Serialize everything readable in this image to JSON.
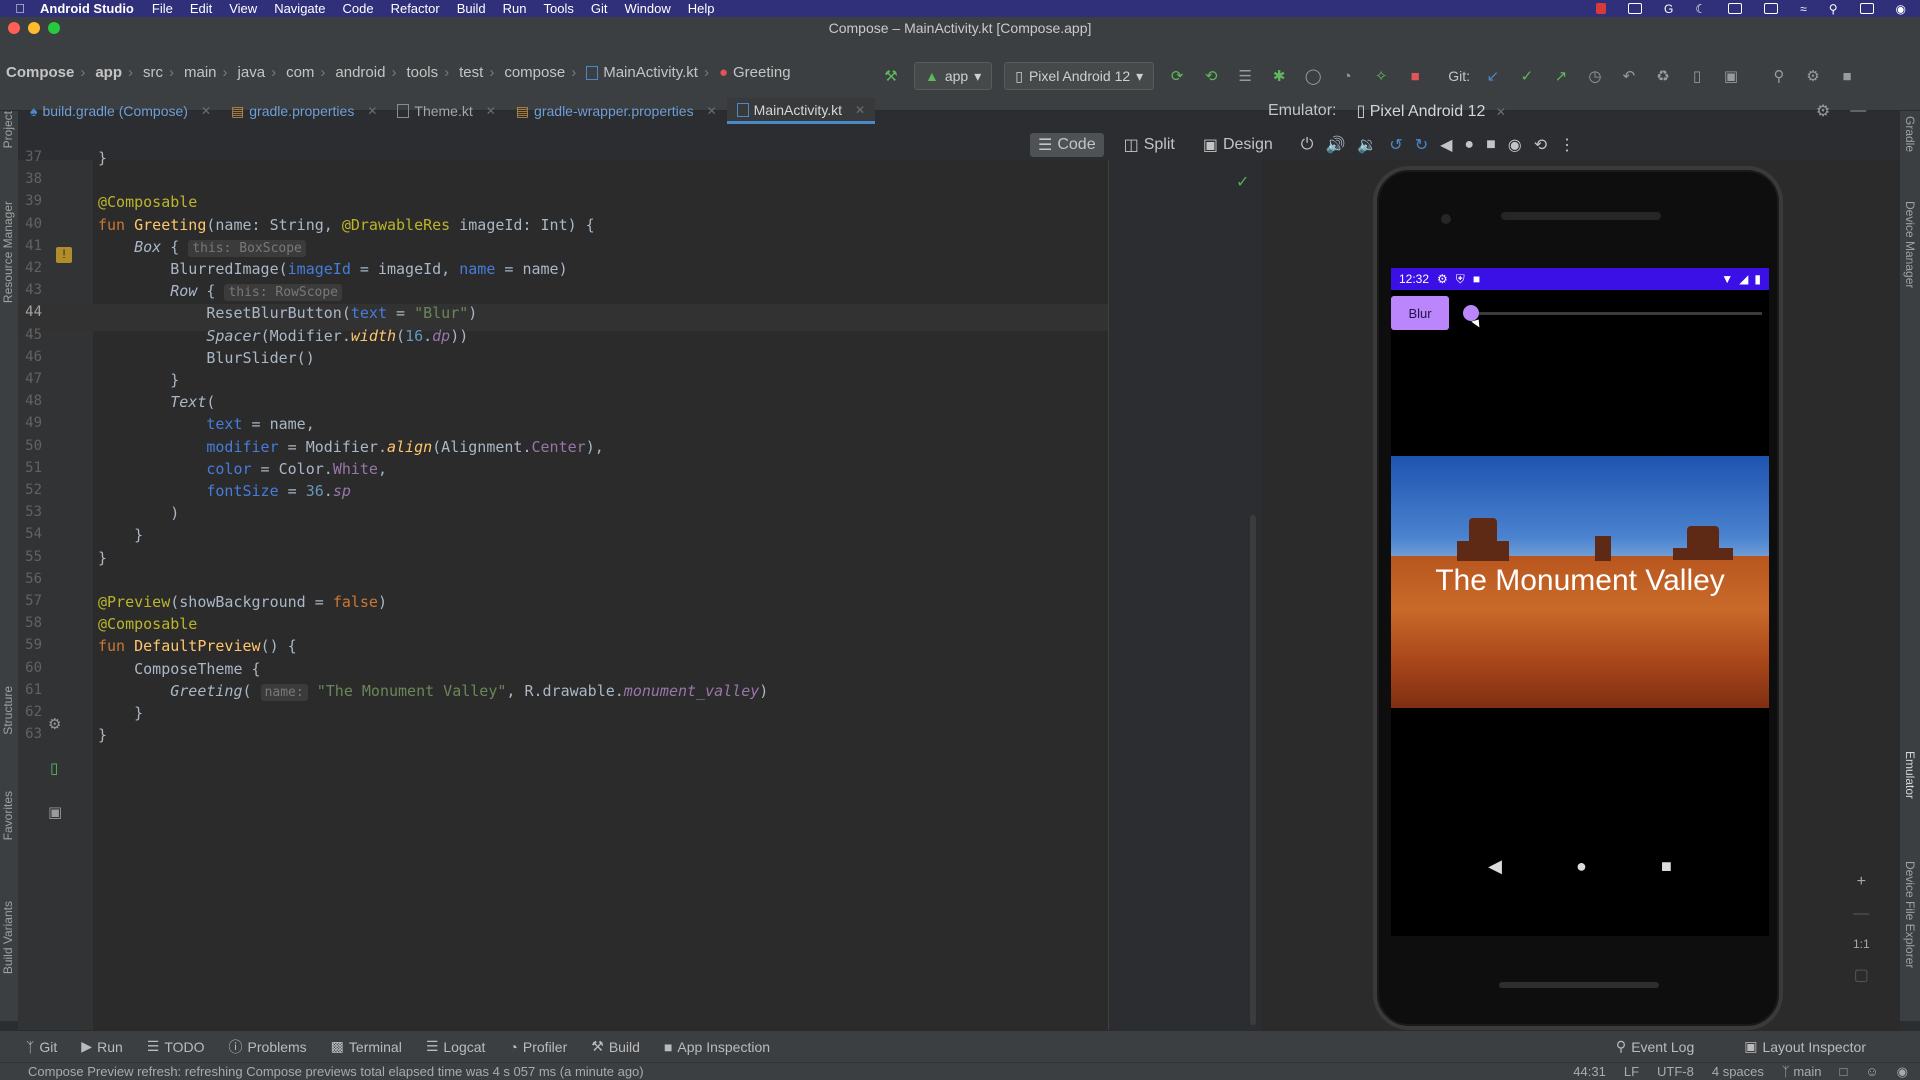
{
  "menubar": {
    "app_name": "Android Studio",
    "menus": [
      "File",
      "Edit",
      "View",
      "Navigate",
      "Code",
      "Refactor",
      "Build",
      "Run",
      "Tools",
      "Git",
      "Window",
      "Help"
    ]
  },
  "window": {
    "title": "Compose – MainActivity.kt [Compose.app]"
  },
  "breadcrumbs": [
    "Compose",
    "app",
    "src",
    "main",
    "java",
    "com",
    "android",
    "tools",
    "test",
    "compose",
    "MainActivity.kt",
    "Greeting"
  ],
  "toolbar": {
    "run_config": "app",
    "device": "Pixel Android 12",
    "git_label": "Git:"
  },
  "tabs": [
    {
      "label": "build.gradle (Compose)"
    },
    {
      "label": "gradle.properties"
    },
    {
      "label": "Theme.kt"
    },
    {
      "label": "gradle-wrapper.properties"
    },
    {
      "label": "MainActivity.kt",
      "active": true
    }
  ],
  "emulator": {
    "label": "Emulator:",
    "device_tab": "Pixel Android 12"
  },
  "design_modes": [
    "Code",
    "Split",
    "Design"
  ],
  "side_panels": {
    "left": [
      "Project",
      "Resource Manager",
      "Structure",
      "Favorites",
      "Build Variants"
    ],
    "right": [
      "Gradle",
      "Device Manager",
      "Emulator",
      "Device File Explorer"
    ]
  },
  "code_lines": [
    {
      "n": "37",
      "parts": [
        [
          "",
          "}"
        ]
      ]
    },
    {
      "n": "38",
      "parts": []
    },
    {
      "n": "39",
      "parts": [
        [
          "ann",
          "@Composable"
        ]
      ]
    },
    {
      "n": "40",
      "parts": [
        [
          "kw",
          "fun "
        ],
        [
          "fn",
          "Greeting"
        ],
        [
          "",
          "(name: String, "
        ],
        [
          "ann",
          "@DrawableRes"
        ],
        [
          "",
          " imageId: Int) {"
        ]
      ]
    },
    {
      "n": "41",
      "parts": [
        [
          "",
          "    "
        ],
        [
          "it",
          "Box"
        ],
        [
          "",
          " { "
        ],
        [
          "hint",
          "this: BoxScope"
        ]
      ]
    },
    {
      "n": "42",
      "parts": [
        [
          "",
          "        BlurredImage("
        ],
        [
          "prm",
          "imageId"
        ],
        [
          "",
          " = imageId, "
        ],
        [
          "prm",
          "name"
        ],
        [
          "",
          " = name)"
        ]
      ]
    },
    {
      "n": "43",
      "parts": [
        [
          "",
          "        "
        ],
        [
          "it",
          "Row"
        ],
        [
          "",
          " { "
        ],
        [
          "hint",
          "this: RowScope"
        ]
      ]
    },
    {
      "n": "44",
      "parts": [
        [
          "",
          "            ResetBlurButton("
        ],
        [
          "prm",
          "text"
        ],
        [
          "",
          " = "
        ],
        [
          "str",
          "\"Blur\""
        ],
        [
          "",
          ")"
        ]
      ],
      "current": true
    },
    {
      "n": "45",
      "parts": [
        [
          "",
          "            "
        ],
        [
          "it",
          "Spacer"
        ],
        [
          "",
          "(Modifier."
        ],
        [
          "fn it",
          "width"
        ],
        [
          "",
          "("
        ],
        [
          "num",
          "16"
        ],
        [
          "",
          "."
        ],
        [
          "prop it",
          "dp"
        ],
        [
          "",
          "))"
        ]
      ]
    },
    {
      "n": "46",
      "parts": [
        [
          "",
          "            BlurSlider()"
        ]
      ]
    },
    {
      "n": "47",
      "parts": [
        [
          "",
          "        }"
        ]
      ]
    },
    {
      "n": "48",
      "parts": [
        [
          "",
          "        "
        ],
        [
          "it",
          "Text"
        ],
        [
          "",
          "("
        ]
      ]
    },
    {
      "n": "49",
      "parts": [
        [
          "",
          "            "
        ],
        [
          "prm",
          "text"
        ],
        [
          "",
          " = name,"
        ]
      ]
    },
    {
      "n": "50",
      "parts": [
        [
          "",
          "            "
        ],
        [
          "prm",
          "modifier"
        ],
        [
          "",
          " = Modifier."
        ],
        [
          "fn it",
          "align"
        ],
        [
          "",
          "(Alignment."
        ],
        [
          "prop",
          "Center"
        ],
        [
          "",
          "),"
        ]
      ]
    },
    {
      "n": "51",
      "parts": [
        [
          "",
          "            "
        ],
        [
          "prm",
          "color"
        ],
        [
          "",
          " = Color."
        ],
        [
          "prop",
          "White"
        ],
        [
          "",
          ","
        ]
      ]
    },
    {
      "n": "52",
      "parts": [
        [
          "",
          "            "
        ],
        [
          "prm",
          "fontSize"
        ],
        [
          "",
          " = "
        ],
        [
          "num",
          "36"
        ],
        [
          "",
          "."
        ],
        [
          "prop it",
          "sp"
        ]
      ]
    },
    {
      "n": "53",
      "parts": [
        [
          "",
          "        )"
        ]
      ]
    },
    {
      "n": "54",
      "parts": [
        [
          "",
          "    }"
        ]
      ]
    },
    {
      "n": "55",
      "parts": [
        [
          "",
          "}"
        ]
      ]
    },
    {
      "n": "56",
      "parts": []
    },
    {
      "n": "57",
      "parts": [
        [
          "ann",
          "@Preview"
        ],
        [
          "",
          "(showBackground = "
        ],
        [
          "kw",
          "false"
        ],
        [
          "",
          ")"
        ]
      ]
    },
    {
      "n": "58",
      "parts": [
        [
          "ann",
          "@Composable"
        ]
      ]
    },
    {
      "n": "59",
      "parts": [
        [
          "kw",
          "fun "
        ],
        [
          "fn",
          "DefaultPreview"
        ],
        [
          "",
          "() {"
        ]
      ]
    },
    {
      "n": "60",
      "parts": [
        [
          "",
          "    ComposeTheme {"
        ]
      ]
    },
    {
      "n": "61",
      "parts": [
        [
          "",
          "        "
        ],
        [
          "it",
          "Greeting"
        ],
        [
          "",
          "( "
        ],
        [
          "hint",
          "name:"
        ],
        [
          "str",
          " \"The Monument Valley\""
        ],
        [
          "",
          ", R.drawable."
        ],
        [
          "prop it",
          "monument_valley"
        ],
        [
          "",
          ")"
        ]
      ]
    },
    {
      "n": "62",
      "parts": [
        [
          "",
          "    }"
        ]
      ]
    },
    {
      "n": "63",
      "parts": [
        [
          "",
          "}"
        ]
      ]
    }
  ],
  "phone": {
    "time": "12:32",
    "button_label": "Blur",
    "image_caption": "The Monument Valley",
    "blur_level": 0
  },
  "zoom": {
    "ratio_label": "1:1"
  },
  "bottom_tools": [
    "Git",
    "Run",
    "TODO",
    "Problems",
    "Terminal",
    "Logcat",
    "Profiler",
    "Build",
    "App Inspection"
  ],
  "bottom_right_tools": [
    "Event Log",
    "Layout Inspector"
  ],
  "status": {
    "message": "Compose Preview refresh: refreshing Compose previews total elapsed time was 4 s 057 ms (a minute ago)",
    "position": "44:31",
    "line_sep": "LF",
    "encoding": "UTF-8",
    "indent": "4 spaces",
    "branch": "main"
  },
  "colors": {
    "accent": "#4a88c7",
    "purple": "#bb86fc",
    "statusbar": "#3a10e6"
  }
}
